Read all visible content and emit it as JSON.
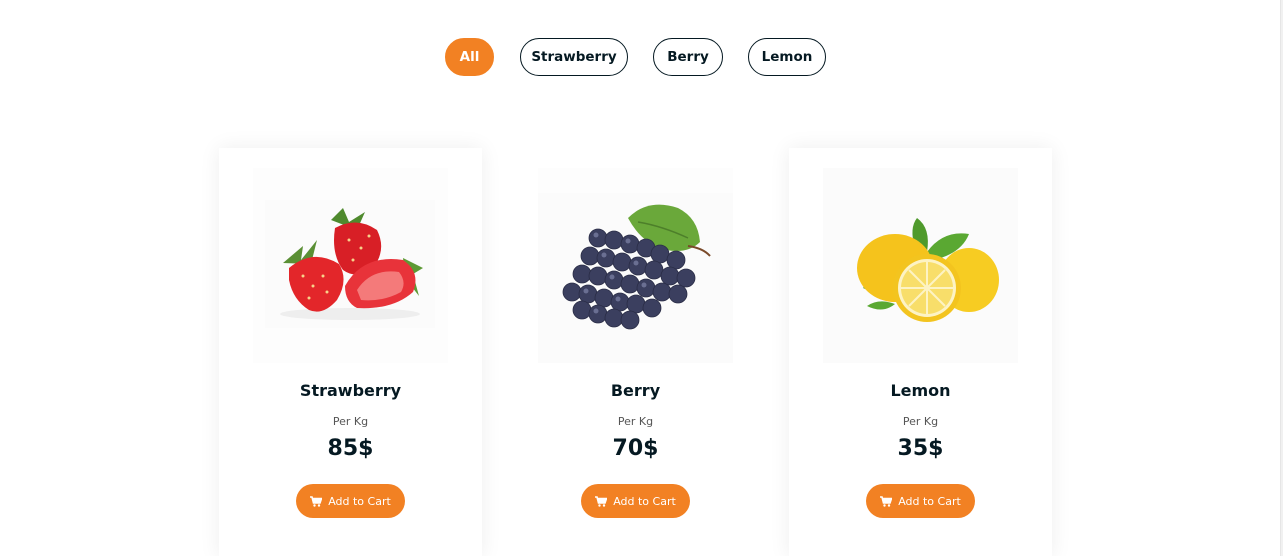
{
  "filters": [
    {
      "label": "All",
      "active": true
    },
    {
      "label": "Strawberry",
      "active": false
    },
    {
      "label": "Berry",
      "active": false
    },
    {
      "label": "Lemon",
      "active": false
    }
  ],
  "products": [
    {
      "name": "Strawberry",
      "unit": "Per Kg",
      "price": "85$",
      "button": "Add to Cart",
      "image": "strawberry-image"
    },
    {
      "name": "Berry",
      "unit": "Per Kg",
      "price": "70$",
      "button": "Add to Cart",
      "image": "grape-image"
    },
    {
      "name": "Lemon",
      "unit": "Per Kg",
      "price": "35$",
      "button": "Add to Cart",
      "image": "lemon-image"
    }
  ],
  "colors": {
    "accent": "#f28123",
    "text": "#051922"
  }
}
